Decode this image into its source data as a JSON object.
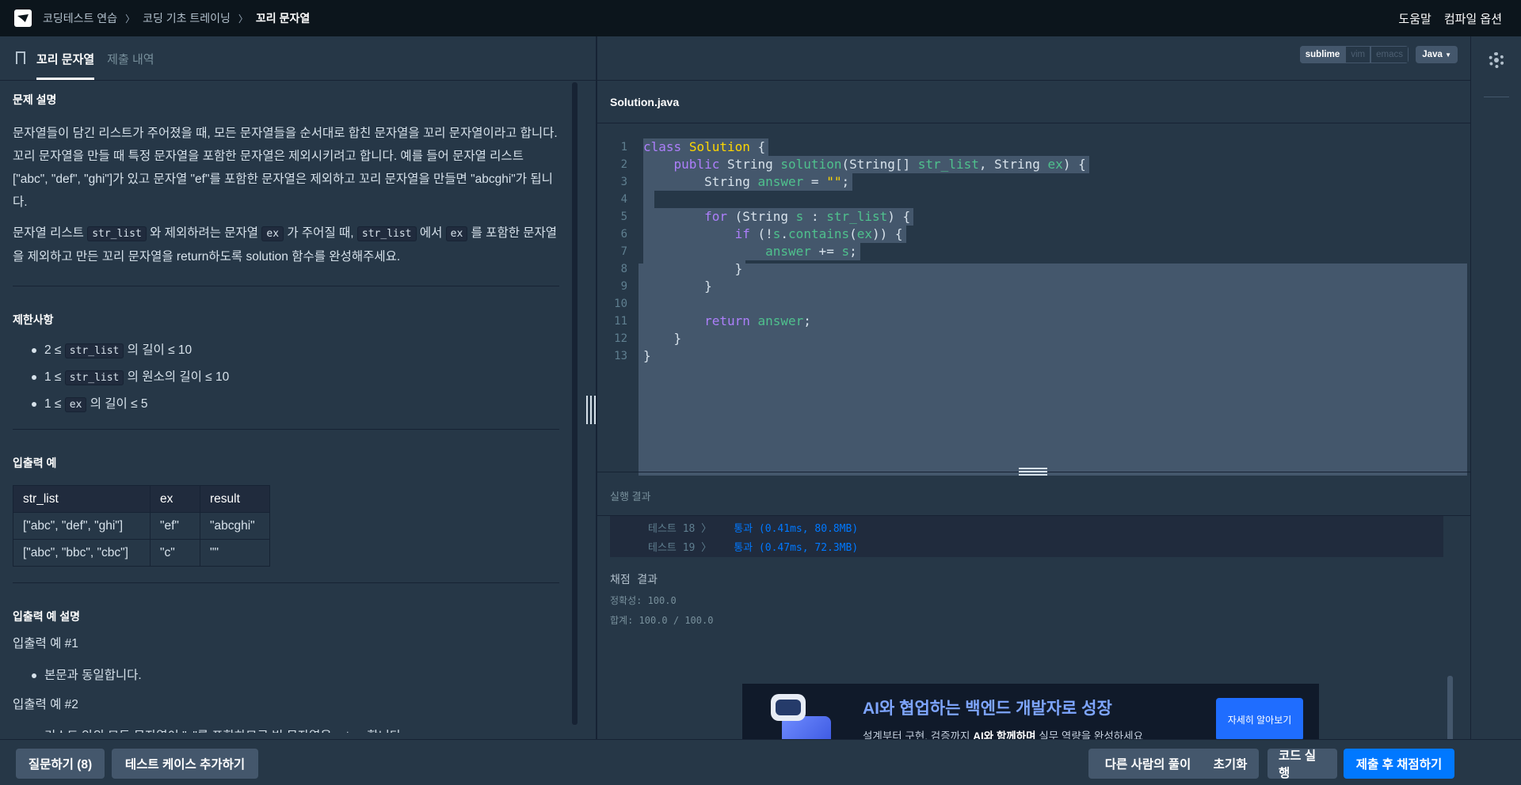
{
  "breadcrumb": [
    "코딩테스트 연습",
    "코딩 기초 트레이닝",
    "꼬리 문자열"
  ],
  "topnav": {
    "help": "도움말",
    "compile_options": "컴파일 옵션"
  },
  "tabs": {
    "problem": "꼬리 문자열",
    "submissions": "제출 내역"
  },
  "problem": {
    "desc_heading": "문제 설명",
    "desc_p1": "문자열들이 담긴 리스트가 주어졌을 때, 모든 문자열들을 순서대로 합친 문자열을 꼬리 문자열이라고 합니다. 꼬리 문자열을 만들 때 특정 문자열을 포함한 문자열은 제외시키려고 합니다. 예를 들어 문자열 리스트 [\"abc\", \"def\", \"ghi\"]가 있고 문자열 \"ef\"를 포함한 문자열은 제외하고 꼬리 문자열을 만들면 \"abcghi\"가 됩니다.",
    "desc_p2": {
      "t1": "문자열 리스트 ",
      "c1": "str_list",
      "t2": " 와 제외하려는 문자열 ",
      "c2": "ex",
      "t3": " 가 주어질 때, ",
      "c3": "str_list",
      "t4": " 에서 ",
      "c4": "ex",
      "t5": " 를 포함한 문자열을 제외하고 만든 꼬리 문자열을 return하도록 solution 함수를 완성해주세요."
    },
    "constraints_heading": "제한사항",
    "constraints": [
      {
        "pre": "2 ≤ ",
        "code": "str_list",
        "post": " 의 길이 ≤ 10"
      },
      {
        "pre": "1 ≤ ",
        "code": "str_list",
        "post": " 의 원소의 길이 ≤ 10"
      },
      {
        "pre": "1 ≤ ",
        "code": "ex",
        "post": " 의 길이 ≤ 5"
      }
    ],
    "io_heading": "입출력 예",
    "io_headers": [
      "str_list",
      "ex",
      "result"
    ],
    "io_rows": [
      [
        "[\"abc\", \"def\", \"ghi\"]",
        "\"ef\"",
        "\"abcghi\""
      ],
      [
        "[\"abc\", \"bbc\", \"cbc\"]",
        "\"c\"",
        "\"\""
      ]
    ],
    "io_desc_heading": "입출력 예 설명",
    "ex1_title": "입출력 예 #1",
    "ex1_item": "본문과 동일합니다.",
    "ex2_title": "입출력 예 #2",
    "ex2_item": "리스트 안의 모든 문자열이 \"c\"를 포함하므로 빈 문자열을 return합니다."
  },
  "editor": {
    "keymaps": [
      "sublime",
      "vim",
      "emacs"
    ],
    "active_keymap": "sublime",
    "language": "Java",
    "file_name": "Solution.java",
    "line_numbers": [
      "1",
      "2",
      "3",
      "4",
      "5",
      "6",
      "7",
      "8",
      "9",
      "10",
      "11",
      "12",
      "13"
    ]
  },
  "result": {
    "title": "실행 결과",
    "tests": [
      {
        "label": "테스트 18 〉",
        "status": "통과 (0.41ms, 80.8MB)"
      },
      {
        "label": "테스트 19 〉",
        "status": "통과 (0.47ms, 72.3MB)"
      }
    ],
    "grade_title": "채점 결과",
    "accuracy": "정확성: 100.0",
    "total": "합계: 100.0 / 100.0"
  },
  "banner": {
    "headline": "AI와 협업하는 백엔드 개발자로 성장",
    "sub_pre": "설계부터 구현, 검증까지 ",
    "sub_bold": "AI와 함께하며",
    "sub_post": " 실무 역량을 완성하세요",
    "button": "자세히 알아보기"
  },
  "bottom": {
    "ask": "질문하기 (8)",
    "add_test": "테스트 케이스 추가하기",
    "others": "다른 사람의 풀이",
    "reset": "초기화",
    "run": "코드 실행",
    "submit": "제출 후 채점하기"
  },
  "colors": {
    "primary": "#0078ff",
    "background": "#263747",
    "topnav": "#0c151c"
  }
}
